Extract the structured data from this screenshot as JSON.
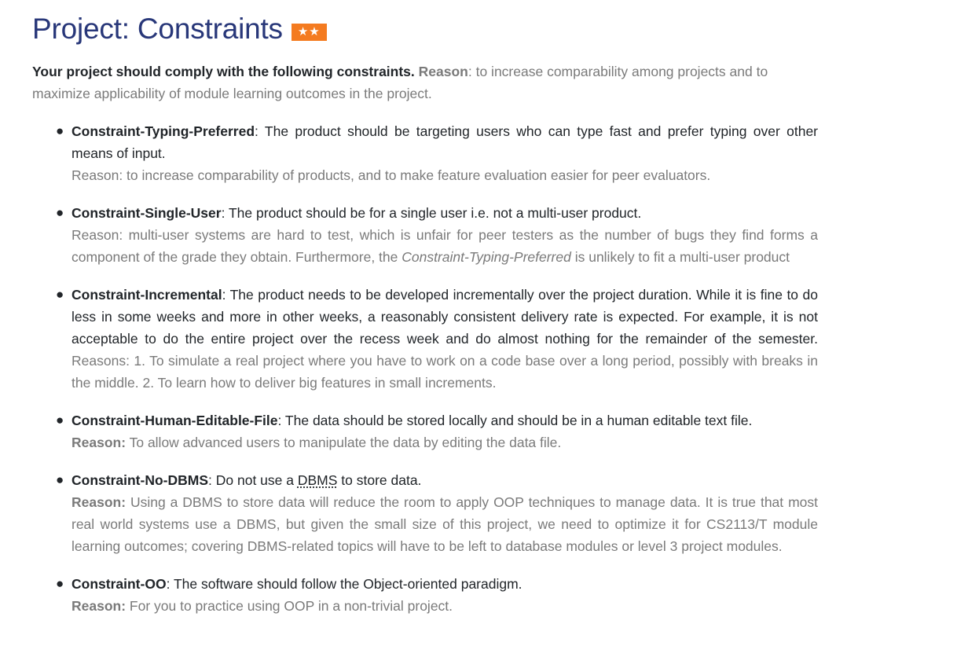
{
  "header": {
    "title": "Project: Constraints",
    "badge": "★★"
  },
  "intro": {
    "lead": "Your project should comply with the following constraints.",
    "reason_label": "Reason",
    "reason_text": ": to increase comparability among projects and to maximize applicability of module learning outcomes in the project."
  },
  "constraints": [
    {
      "name": "Constraint-Typing-Preferred",
      "description": ": The product should be targeting users who can type fast and prefer typing over other means of input.",
      "reason": "Reason: to increase comparability of products, and to make feature evaluation easier for peer evaluators."
    },
    {
      "name": "Constraint-Single-User",
      "description": ": The product should be for a single user i.e. not a multi-user product.",
      "reason_before": "Reason: multi-user systems are hard to test, which is unfair for peer testers as the number of bugs they find forms a component of the grade they obtain. Furthermore, the ",
      "reason_em": "Constraint-Typing-Preferred",
      "reason_after": " is unlikely to fit a multi-user product"
    },
    {
      "name": "Constraint-Incremental",
      "description": ": The product needs to be developed incrementally over the project duration. While it is fine to do less in some weeks and more in other weeks, a reasonably consistent delivery rate is expected. For example, it is not acceptable to do the entire project over the recess week and do almost nothing for the remainder of the semester.",
      "reason": " Reasons: 1. To simulate a real project where you have to work on a code base over a long period, possibly with breaks in the middle. 2. To learn how to deliver big features in small increments."
    },
    {
      "name": "Constraint-Human-Editable-File",
      "description": ": The data should be stored locally and should be in a human editable text file.",
      "reason_label": "Reason:",
      "reason": " To allow advanced users to manipulate the data by editing the data file."
    },
    {
      "name": "Constraint-No-DBMS",
      "description_before": ": Do not use a ",
      "description_abbr": "DBMS",
      "description_after": " to store data.",
      "reason_label": "Reason:",
      "reason": " Using a DBMS to store data will reduce the room to apply OOP techniques to manage data. It is true that most real world systems use a DBMS, but given the small size of this project, we need to optimize it for CS2113/T module learning outcomes; covering DBMS-related topics will have to be left to database modules or level 3 project modules."
    },
    {
      "name": "Constraint-OO",
      "description": ": The software should follow the Object-oriented paradigm.",
      "reason_label": "Reason:",
      "reason": " For you to practice using OOP in a non-trivial project."
    }
  ]
}
